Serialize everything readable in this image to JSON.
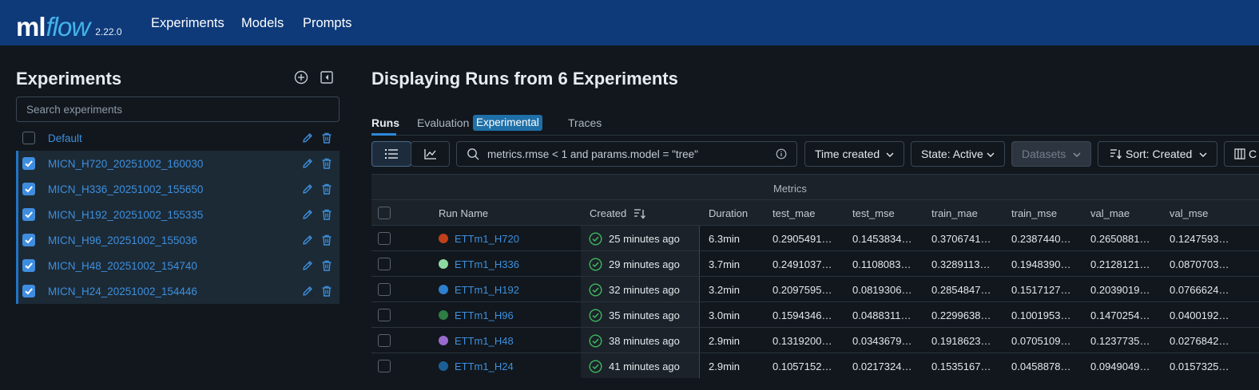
{
  "app": {
    "logo_ml": "ml",
    "logo_flow": "flow",
    "version": "2.22.0",
    "nav": [
      "Experiments",
      "Models",
      "Prompts"
    ]
  },
  "sidebar": {
    "title": "Experiments",
    "search_placeholder": "Search experiments",
    "experiments": [
      {
        "name": "Default",
        "checked": false
      },
      {
        "name": "MICN_H720_20251002_160030",
        "checked": true
      },
      {
        "name": "MICN_H336_20251002_155650",
        "checked": true
      },
      {
        "name": "MICN_H192_20251002_155335",
        "checked": true
      },
      {
        "name": "MICN_H96_20251002_155036",
        "checked": true
      },
      {
        "name": "MICN_H48_20251002_154740",
        "checked": true
      },
      {
        "name": "MICN_H24_20251002_154446",
        "checked": true
      }
    ]
  },
  "main": {
    "title": "Displaying Runs from 6 Experiments",
    "tabs": {
      "runs": "Runs",
      "evaluation": "Evaluation",
      "experimental_badge": "Experimental",
      "traces": "Traces"
    },
    "filter_query": "metrics.rmse < 1 and params.model = \"tree\"",
    "dropdowns": {
      "time": "Time created",
      "state": "State: Active",
      "datasets": "Datasets",
      "sort": "Sort: Created",
      "columns": "C"
    },
    "table": {
      "group_label": "Metrics",
      "headers": {
        "run_name": "Run Name",
        "created": "Created",
        "duration": "Duration",
        "test_mae": "test_mae",
        "test_mse": "test_mse",
        "train_mae": "train_mae",
        "train_mse": "train_mse",
        "val_mae": "val_mae",
        "val_mse": "val_mse"
      },
      "rows": [
        {
          "run_name": "ETTm1_H720",
          "color": "#c0401b",
          "created": "25 minutes ago",
          "duration": "6.3min",
          "test_mae": "0.2905491…",
          "test_mse": "0.1453834…",
          "train_mae": "0.3706741…",
          "train_mse": "0.2387440…",
          "val_mae": "0.2650881…",
          "val_mse": "0.1247593…"
        },
        {
          "run_name": "ETTm1_H336",
          "color": "#8fd8a0",
          "created": "29 minutes ago",
          "duration": "3.7min",
          "test_mae": "0.2491037…",
          "test_mse": "0.1108083…",
          "train_mae": "0.3289113…",
          "train_mse": "0.1948390…",
          "val_mae": "0.2128121…",
          "val_mse": "0.0870703…"
        },
        {
          "run_name": "ETTm1_H192",
          "color": "#2f7fcf",
          "created": "32 minutes ago",
          "duration": "3.2min",
          "test_mae": "0.2097595…",
          "test_mse": "0.0819306…",
          "train_mae": "0.2854847…",
          "train_mse": "0.1517127…",
          "val_mae": "0.2039019…",
          "val_mse": "0.0766624…"
        },
        {
          "run_name": "ETTm1_H96",
          "color": "#2e7d44",
          "created": "35 minutes ago",
          "duration": "3.0min",
          "test_mae": "0.1594346…",
          "test_mse": "0.0488311…",
          "train_mae": "0.2299638…",
          "train_mse": "0.1001953…",
          "val_mae": "0.1470254…",
          "val_mse": "0.0400192…"
        },
        {
          "run_name": "ETTm1_H48",
          "color": "#9b6acf",
          "created": "38 minutes ago",
          "duration": "2.9min",
          "test_mae": "0.1319200…",
          "test_mse": "0.0343679…",
          "train_mae": "0.1918623…",
          "train_mse": "0.0705109…",
          "val_mae": "0.1237735…",
          "val_mse": "0.0276842…"
        },
        {
          "run_name": "ETTm1_H24",
          "color": "#1c5f96",
          "created": "41 minutes ago",
          "duration": "2.9min",
          "test_mae": "0.1057152…",
          "test_mse": "0.0217324…",
          "train_mae": "0.1535167…",
          "train_mse": "0.0458878…",
          "val_mae": "0.0949049…",
          "val_mse": "0.0157325…"
        }
      ]
    }
  }
}
